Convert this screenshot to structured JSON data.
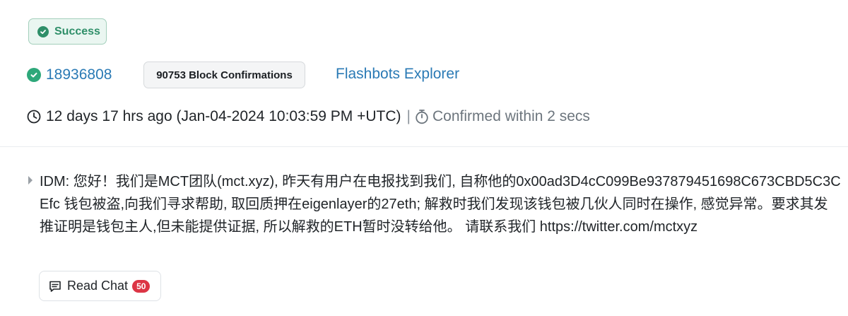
{
  "status": {
    "label": "Success",
    "icon": "check-circle-icon",
    "color": "#2f8f69"
  },
  "block": {
    "number": "18936808",
    "confirmations": "90753 Block Confirmations",
    "explorer_link": "Flashbots Explorer"
  },
  "timestamp": {
    "relative": "12 days 17 hrs ago (Jan-04-2024 10:03:59 PM +UTC)",
    "separator": "|",
    "confirmed": "Confirmed within 2 secs"
  },
  "input_message": {
    "text": "IDM: 您好！我们是MCT团队(mct.xyz), 昨天有用户在电报找到我们, 自称他的0x00ad3D4cC099Be937879451698C673CBD5C3CEfc 钱包被盗,向我们寻求帮助, 取回质押在eigenlayer的27eth; 解救时我们发现该钱包被几伙人同时在操作, 感觉异常。要求其发推证明是钱包主人,但未能提供证据, 所以解救的ETH暂时没转给他。 请联系我们 https://twitter.com/mctxyz"
  },
  "chat": {
    "label": "Read Chat",
    "count": "50"
  },
  "colors": {
    "link": "#2a7ab5",
    "success": "#2ea87a",
    "badge_red": "#dc3545"
  }
}
